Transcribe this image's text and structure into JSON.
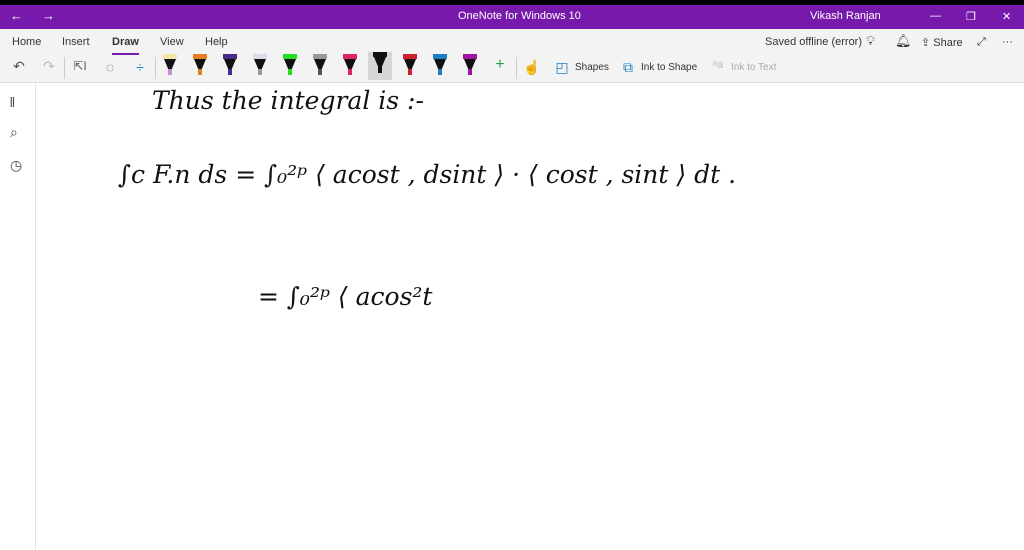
{
  "titlebar": {
    "title": "OneNote for Windows 10",
    "user": "Vikash Ranjan",
    "back": "←",
    "forward": "→",
    "minimize": "—",
    "restore": "❐",
    "close": "✕"
  },
  "ribbon": {
    "tabs": [
      "Home",
      "Insert",
      "Draw",
      "View",
      "Help"
    ],
    "active_tab": "Draw",
    "status": "Saved offline (error)",
    "share": "Share",
    "more": "···",
    "tools": {
      "shapes": "Shapes",
      "ink_to_shape": "Ink to Shape",
      "ink_to_text": "Ink to Text"
    },
    "pens": [
      {
        "cap": "#f5e6a8",
        "tip": "#c58fd6"
      },
      {
        "cap": "#e67e22",
        "tip": "#e67e22"
      },
      {
        "cap": "#4b2a8a",
        "tip": "#4b2a8a"
      },
      {
        "cap": "#d8dcec",
        "tip": "#999"
      },
      {
        "cap": "#22dd22",
        "tip": "#22dd22"
      },
      {
        "cap": "#999",
        "tip": "#555"
      },
      {
        "cap": "#e0245e",
        "tip": "#e0245e"
      },
      {
        "cap": "#111",
        "tip": "#111"
      },
      {
        "cap": "#d0202e",
        "tip": "#d0202e"
      },
      {
        "cap": "#1c7fc4",
        "tip": "#1c7fc4"
      },
      {
        "cap": "#a0139e",
        "tip": "#a0139e"
      }
    ]
  },
  "page": {
    "lines": [
      "Thus the integral is :-",
      "∫c F.n ds  =  ∫₀²ᵖ ⟨ acost , dsint ⟩ · ⟨ cost , sint ⟩ dt .",
      "=  ∫₀²ᵖ ⟨ acos²t"
    ]
  }
}
